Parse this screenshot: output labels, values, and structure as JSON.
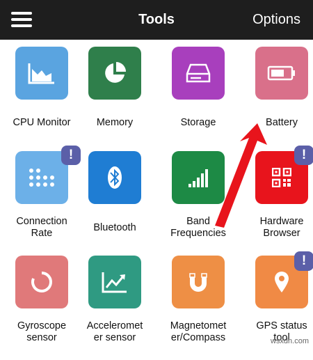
{
  "header": {
    "title": "Tools",
    "options_label": "Options"
  },
  "colors": {
    "topbar": "#1e1e1e",
    "cpu": "#5aa4e0",
    "memory": "#2f7f4b",
    "storage": "#a83fbd",
    "battery": "#d9708a",
    "connection": "#6cb0e8",
    "bluetooth": "#1f7dd3",
    "band": "#1d8a45",
    "hardware": "#e8141c",
    "gyroscope": "#e0797a",
    "accelerometer": "#2f9a82",
    "magnetometer": "#ee8f45",
    "gps": "#f08a45",
    "badge": "#5b5fa8",
    "arrow": "#e8141c"
  },
  "tiles": [
    {
      "label": "CPU Monitor",
      "icon": "area-chart-icon"
    },
    {
      "label": "Memory",
      "icon": "pie-chart-icon"
    },
    {
      "label": "Storage",
      "icon": "hard-drive-icon"
    },
    {
      "label": "Battery",
      "icon": "battery-icon"
    },
    {
      "label": "Connection\nRate",
      "icon": "dot-grid-icon",
      "badge": "!"
    },
    {
      "label": "Bluetooth",
      "icon": "bluetooth-icon"
    },
    {
      "label": "Band\nFrequencies",
      "icon": "signal-bars-icon"
    },
    {
      "label": "Hardware\nBrowser",
      "icon": "qr-code-icon",
      "badge": "!"
    },
    {
      "label": "Gyroscope\nsensor",
      "icon": "ring-icon"
    },
    {
      "label": "Acceleromet\ner sensor",
      "icon": "trend-chart-icon"
    },
    {
      "label": "Magnetomet\ner/Compass",
      "icon": "magnet-icon"
    },
    {
      "label": "GPS status\ntool",
      "icon": "location-pin-icon",
      "badge": "!"
    }
  ],
  "watermark": "wsxdn.com"
}
